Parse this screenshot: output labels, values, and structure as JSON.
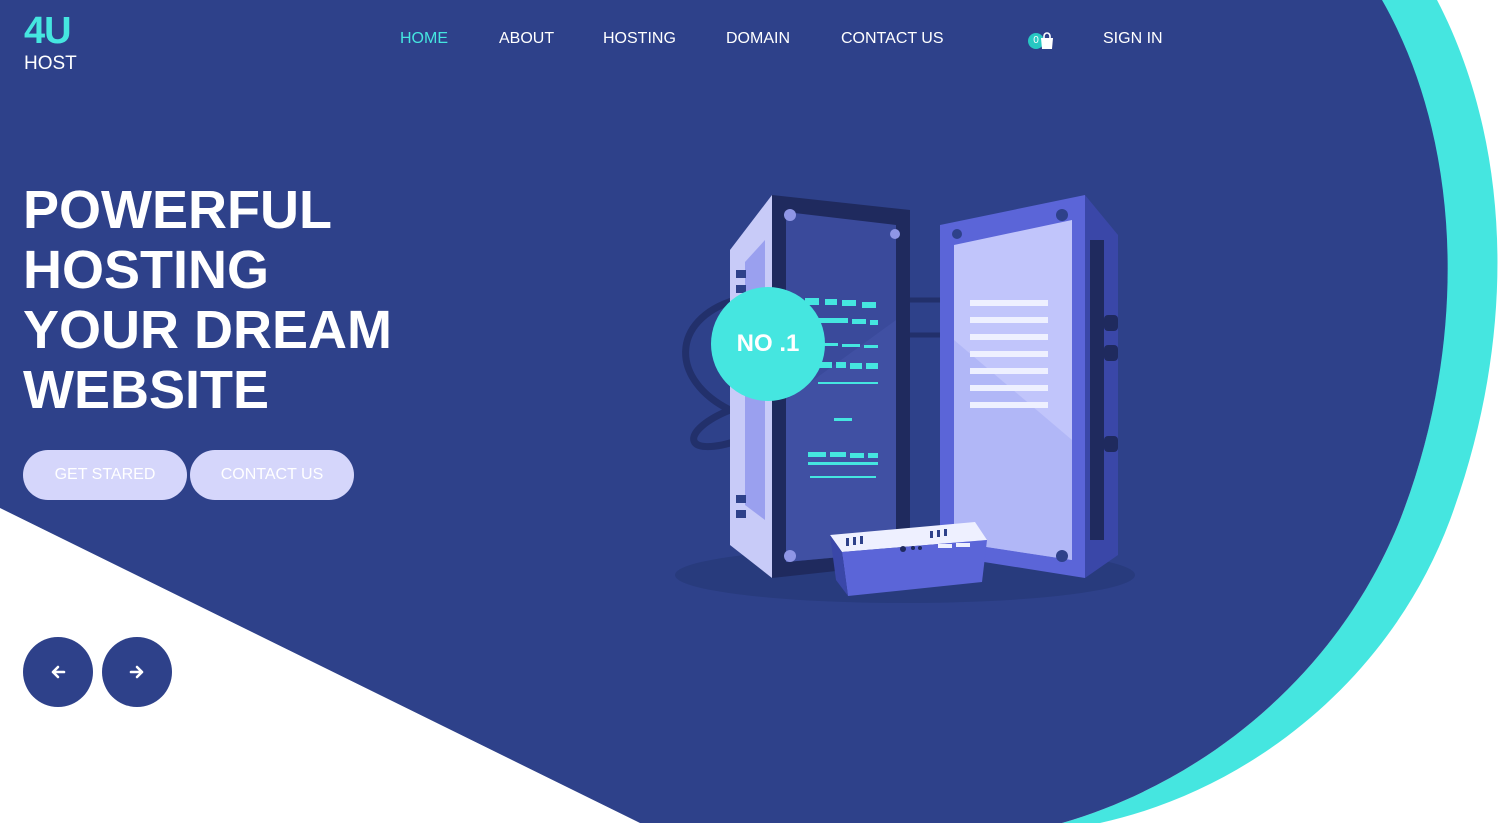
{
  "brand": {
    "mark": "4U",
    "name": "HOST"
  },
  "nav": {
    "items": [
      {
        "label": "HOME",
        "active": true
      },
      {
        "label": "ABOUT",
        "active": false
      },
      {
        "label": "HOSTING",
        "active": false
      },
      {
        "label": "DOMAIN",
        "active": false
      },
      {
        "label": "CONTACT US",
        "active": false
      }
    ],
    "cart_count": "0",
    "sign_in": "SIGN IN"
  },
  "hero": {
    "title_lines": [
      "POWERFUL",
      "HOSTING",
      "YOUR DREAM",
      "WEBSITE"
    ],
    "primary_button": "GET STARED",
    "secondary_button": "CONTACT US",
    "badge": "NO .1"
  },
  "slider": {
    "prev_icon": "arrow-left-icon",
    "next_icon": "arrow-right-icon"
  },
  "colors": {
    "primary": "#2e418a",
    "accent": "#45e6e0",
    "button": "#d5d6fb",
    "background": "#ffffff"
  }
}
